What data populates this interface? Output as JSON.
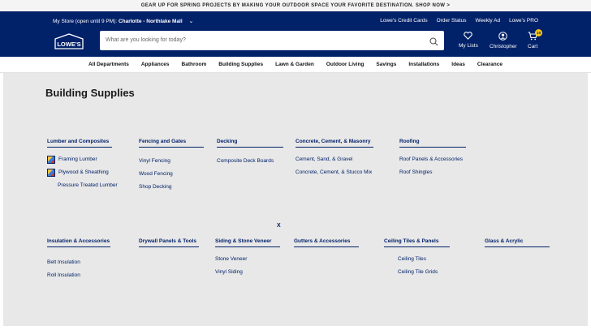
{
  "promo": {
    "text": "GEAR UP FOR SPRING PROJECTS BY MAKING YOUR OUTDOOR SPACE YOUR FAVORITE DESTINATION. SHOP NOW >"
  },
  "header": {
    "store_prefix": "My Store (open until 9 PM):",
    "store_name": "Charlotte - Northlake Mall",
    "top_links": [
      "Lowe's Credit Cards",
      "Order Status",
      "Weekly Ad",
      "Lowe's PRO"
    ],
    "logo_text": "LOWE'S",
    "search_placeholder": "What are you looking for today?",
    "my_lists": "My Lists",
    "account": "Christopher",
    "cart": "Cart",
    "cart_count": "10"
  },
  "nav": [
    "All Departments",
    "Appliances",
    "Bathroom",
    "Building Supplies",
    "Lawn & Garden",
    "Outdoor Living",
    "Savings",
    "Installations",
    "Ideas",
    "Clearance"
  ],
  "page": {
    "title": "Building Supplies",
    "close": "X",
    "row1": [
      {
        "heading": "Lumber and Composites",
        "links": [
          {
            "label": "Framing Lumber",
            "thumb": true
          },
          {
            "label": "Plywood & Sheathing",
            "thumb": true
          },
          {
            "label": "Pressure Treated Lumber",
            "thumb": false
          }
        ]
      },
      {
        "heading": "Fencing and Gates",
        "links": [
          {
            "label": "Vinyl Fencing"
          },
          {
            "label": "Wood Fencing"
          },
          {
            "label": "Shop Decking"
          }
        ]
      },
      {
        "heading": "Decking",
        "links": [
          {
            "label": "Composite Deck Boards"
          }
        ]
      },
      {
        "heading": "Concrete, Cement, & Masonry",
        "links": [
          {
            "label": "Cement, Sand, & Gravel"
          },
          {
            "label": "Concrete, Cement, & Stucco Mix"
          }
        ]
      },
      {
        "heading": "Roofing",
        "links": [
          {
            "label": "Roof Panels & Accessories"
          },
          {
            "label": "Roof Shingles"
          }
        ]
      }
    ],
    "row2": [
      {
        "heading": "Insulation & Accessories",
        "links": [
          {
            "label": "Belt Insulation"
          },
          {
            "label": "Roll Insulation"
          }
        ]
      },
      {
        "heading": "Drywall Panels & Tools",
        "links": []
      },
      {
        "heading": "Siding & Stone Veneer",
        "links": [
          {
            "label": "Stone Veneer"
          },
          {
            "label": "Vinyl Siding"
          }
        ]
      },
      {
        "heading": "Gutters & Accessories",
        "links": []
      },
      {
        "heading": "Ceiling Tiles & Panels",
        "links": [
          {
            "label": "Ceiling Tiles"
          },
          {
            "label": "Ceiling Tile Grids"
          }
        ]
      },
      {
        "heading": "Glass & Acrylic",
        "links": []
      }
    ]
  },
  "colors": {
    "brand_blue": "#012169",
    "badge_yellow": "#f5c518",
    "content_bg": "#e8e8e8"
  }
}
